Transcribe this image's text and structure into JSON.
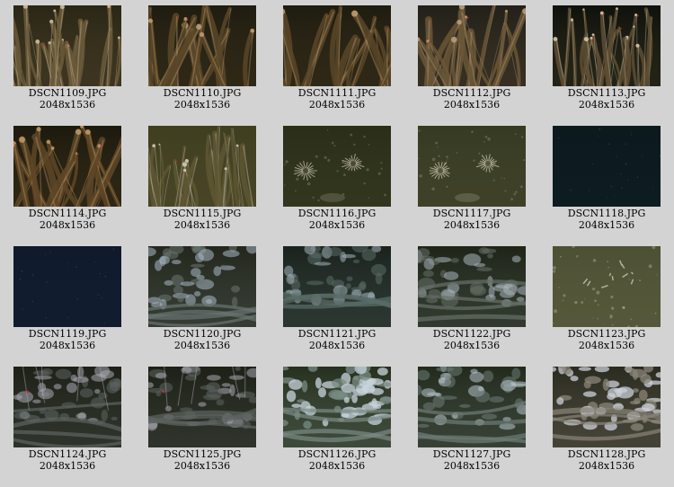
{
  "gallery": {
    "items": [
      {
        "name": "DSCN1109.JPG",
        "size": "2048x1536",
        "scene": "tubeworms",
        "colors": {
          "bg": "#2a2616",
          "mid": "#6b5a3a",
          "hi": "#d8c8a8"
        }
      },
      {
        "name": "DSCN1110.JPG",
        "size": "2048x1536",
        "scene": "tubeworms-close",
        "colors": {
          "bg": "#1e1c10",
          "mid": "#5a4628",
          "hi": "#c8a878"
        }
      },
      {
        "name": "DSCN1111.JPG",
        "size": "2048x1536",
        "scene": "tubeworms-close",
        "colors": {
          "bg": "#1e1c10",
          "mid": "#5a4628",
          "hi": "#c8a878"
        }
      },
      {
        "name": "DSCN1112.JPG",
        "size": "2048x1536",
        "scene": "tubeworms-close",
        "colors": {
          "bg": "#22201a",
          "mid": "#6a5636",
          "hi": "#c0a480"
        }
      },
      {
        "name": "DSCN1113.JPG",
        "size": "2048x1536",
        "scene": "tubeworms",
        "colors": {
          "bg": "#0e120c",
          "mid": "#5e4e32",
          "hi": "#e0d4b8"
        }
      },
      {
        "name": "DSCN1114.JPG",
        "size": "2048x1536",
        "scene": "tubeworms-close",
        "colors": {
          "bg": "#1c1a0e",
          "mid": "#5e4626",
          "hi": "#c8a070"
        }
      },
      {
        "name": "DSCN1115.JPG",
        "size": "2048x1536",
        "scene": "tubeworms-sediment",
        "colors": {
          "bg": "#2e3218",
          "mid": "#5e5632",
          "hi": "#dcd8c8"
        }
      },
      {
        "name": "DSCN1116.JPG",
        "size": "2048x1536",
        "scene": "anemones",
        "colors": {
          "bg": "#2a2e18",
          "mid": "#4a4a2e",
          "hi": "#c8c4b0"
        }
      },
      {
        "name": "DSCN1117.JPG",
        "size": "2048x1536",
        "scene": "anemones",
        "colors": {
          "bg": "#363a22",
          "mid": "#55553a",
          "hi": "#d0ccb8"
        }
      },
      {
        "name": "DSCN1118.JPG",
        "size": "2048x1536",
        "scene": "dark-water",
        "colors": {
          "bg": "#0c1a1e",
          "mid": "#102028",
          "hi": "#3a5058"
        }
      },
      {
        "name": "DSCN1119.JPG",
        "size": "2048x1536",
        "scene": "dark-water",
        "colors": {
          "bg": "#101a2c",
          "mid": "#142236",
          "hi": "#3c4c64"
        }
      },
      {
        "name": "DSCN1120.JPG",
        "size": "2048x1536",
        "scene": "bacterial-mats",
        "colors": {
          "bg": "#22261c",
          "mid": "#6a7470",
          "hi": "#aab8c4"
        }
      },
      {
        "name": "DSCN1121.JPG",
        "size": "2048x1536",
        "scene": "bacterial-mats",
        "colors": {
          "bg": "#1a221c",
          "mid": "#5a6c68",
          "hi": "#a4b4bc"
        }
      },
      {
        "name": "DSCN1122.JPG",
        "size": "2048x1536",
        "scene": "bacterial-mats",
        "colors": {
          "bg": "#1e2418",
          "mid": "#667068",
          "hi": "#aab4bc"
        }
      },
      {
        "name": "DSCN1123.JPG",
        "size": "2048x1536",
        "scene": "sediment-debris",
        "colors": {
          "bg": "#3a4026",
          "mid": "#6a6a48",
          "hi": "#cac8b4"
        }
      },
      {
        "name": "DSCN1124.JPG",
        "size": "2048x1536",
        "scene": "bacterial-mats-tubes",
        "colors": {
          "bg": "#1c2016",
          "mid": "#5c6460",
          "hi": "#a8a8b0"
        }
      },
      {
        "name": "DSCN1125.JPG",
        "size": "2048x1536",
        "scene": "bacterial-mats-tubes",
        "colors": {
          "bg": "#1c2016",
          "mid": "#5c6460",
          "hi": "#a8a8b0"
        }
      },
      {
        "name": "DSCN1126.JPG",
        "size": "2048x1536",
        "scene": "bacterial-mats-bright",
        "colors": {
          "bg": "#26301e",
          "mid": "#7a8c84",
          "hi": "#c8d4dc"
        }
      },
      {
        "name": "DSCN1127.JPG",
        "size": "2048x1536",
        "scene": "bacterial-mats",
        "colors": {
          "bg": "#222a1c",
          "mid": "#6e7c76",
          "hi": "#b8c4cc"
        }
      },
      {
        "name": "DSCN1128.JPG",
        "size": "2048x1536",
        "scene": "bacterial-mats-bright",
        "colors": {
          "bg": "#2a2a1e",
          "mid": "#8a8478",
          "hi": "#ccd0d8"
        }
      }
    ]
  }
}
